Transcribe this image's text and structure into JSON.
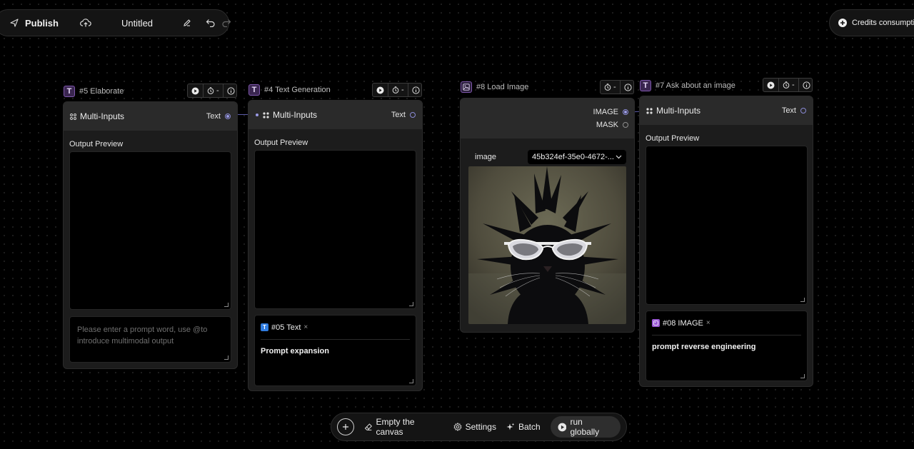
{
  "toolbar": {
    "publish_label": "Publish",
    "title": "Untitled"
  },
  "credits": {
    "label": "Credits consumption"
  },
  "nodes": {
    "elaborate": {
      "badge": "T",
      "title": "#5 Elaborate",
      "ctrl_value": "-",
      "inputs_label": "Multi-Inputs",
      "port_label": "Text",
      "output_label": "Output Preview",
      "prompt_placeholder": "Please enter a prompt word, use @to introduce multimodal output"
    },
    "text_generation": {
      "badge": "T",
      "title": "#4 Text Generation",
      "ctrl_value": "-",
      "inputs_label": "Multi-Inputs",
      "port_label": "Text",
      "output_label": "Output Preview",
      "chip_label": "#05 Text",
      "chip_icon": "T",
      "prompt_text": "Prompt expansion"
    },
    "load_image": {
      "title": "#8 Load Image",
      "ctrl_value": "-",
      "port_image": "IMAGE",
      "port_mask": "MASK",
      "field_label": "image",
      "field_value": "45b324ef-35e0-4672-..."
    },
    "ask_image": {
      "badge": "T",
      "title": "#7 Ask about an image",
      "ctrl_value": "-",
      "inputs_label": "Multi-Inputs",
      "port_label": "Text",
      "output_label": "Output Preview",
      "chip_label": "#08 IMAGE",
      "prompt_text": "prompt reverse engineering"
    }
  },
  "bottombar": {
    "empty_label": "Empty the canvas",
    "settings_label": "Settings",
    "batch_label": "Batch",
    "run_label": "run globally"
  },
  "colors": {
    "background": "#000000",
    "node_badge": "#7f58ad",
    "port_active": "#9a9ae6",
    "chip_text_icon": "#2f7ce0",
    "chip_image_icon": "#9b59d6"
  }
}
